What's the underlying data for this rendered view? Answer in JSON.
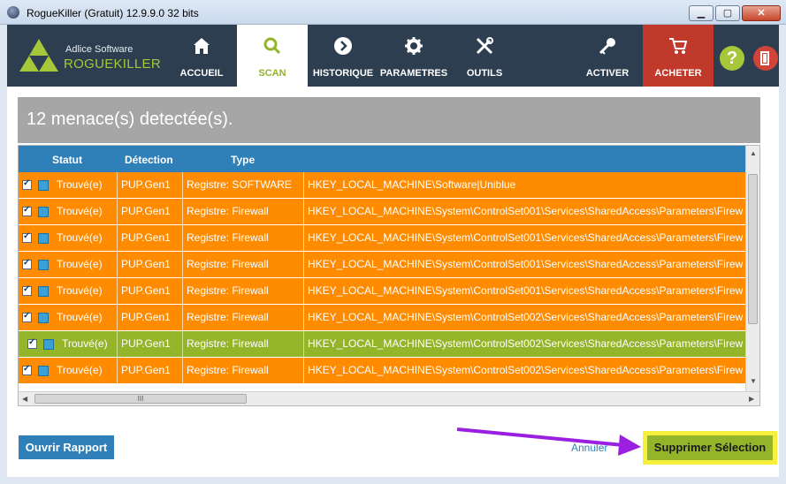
{
  "window": {
    "title": "RogueKiller (Gratuit) 12.9.9.0 32 bits",
    "minimize": "▁",
    "maximize": "▢",
    "close": "✕"
  },
  "brand": {
    "company": "Adlice Software",
    "product": "ROGUEKILLER"
  },
  "nav": [
    {
      "id": "accueil",
      "label": "ACCUEIL",
      "icon": "home-icon"
    },
    {
      "id": "scan",
      "label": "SCAN",
      "icon": "search-icon",
      "active": true
    },
    {
      "id": "historique",
      "label": "HISTORIQUE",
      "icon": "chevron-right-circle-icon"
    },
    {
      "id": "parametres",
      "label": "PARAMETRES",
      "icon": "gear-icon"
    },
    {
      "id": "outils",
      "label": "OUTILS",
      "icon": "tools-icon"
    },
    {
      "id": "activer",
      "label": "ACTIVER",
      "icon": "key-icon"
    },
    {
      "id": "acheter",
      "label": "ACHETER",
      "icon": "cart-icon"
    }
  ],
  "help_label": "?",
  "panel_title": "12 menace(s) detectée(s).",
  "table": {
    "columns": [
      "Statut",
      "Détection",
      "Type",
      ""
    ],
    "rows": [
      {
        "status": "Trouvé(e)",
        "detection": "PUP.Gen1",
        "type": "Registre: SOFTWARE",
        "path": "HKEY_LOCAL_MACHINE\\Software|Uniblue"
      },
      {
        "status": "Trouvé(e)",
        "detection": "PUP.Gen1",
        "type": "Registre: Firewall",
        "path": "HKEY_LOCAL_MACHINE\\System\\ControlSet001\\Services\\SharedAccess\\Parameters\\Firew"
      },
      {
        "status": "Trouvé(e)",
        "detection": "PUP.Gen1",
        "type": "Registre: Firewall",
        "path": "HKEY_LOCAL_MACHINE\\System\\ControlSet001\\Services\\SharedAccess\\Parameters\\Firew"
      },
      {
        "status": "Trouvé(e)",
        "detection": "PUP.Gen1",
        "type": "Registre: Firewall",
        "path": "HKEY_LOCAL_MACHINE\\System\\ControlSet001\\Services\\SharedAccess\\Parameters\\Firew"
      },
      {
        "status": "Trouvé(e)",
        "detection": "PUP.Gen1",
        "type": "Registre: Firewall",
        "path": "HKEY_LOCAL_MACHINE\\System\\ControlSet001\\Services\\SharedAccess\\Parameters\\Firew"
      },
      {
        "status": "Trouvé(e)",
        "detection": "PUP.Gen1",
        "type": "Registre: Firewall",
        "path": "HKEY_LOCAL_MACHINE\\System\\ControlSet002\\Services\\SharedAccess\\Parameters\\Firew"
      },
      {
        "status": "Trouvé(e)",
        "detection": "PUP.Gen1",
        "type": "Registre: Firewall",
        "path": "HKEY_LOCAL_MACHINE\\System\\ControlSet002\\Services\\SharedAccess\\Parameters\\Firew"
      },
      {
        "status": "Trouvé(e)",
        "detection": "PUP.Gen1",
        "type": "Registre: Firewall",
        "path": "HKEY_LOCAL_MACHINE\\System\\ControlSet002\\Services\\SharedAccess\\Parameters\\Firew"
      }
    ],
    "selected_row": 6,
    "hscroll_grip": "III"
  },
  "buttons": {
    "report": "Ouvrir Rapport",
    "cancel": "Annuler",
    "delete": "Supprimer Sélection"
  },
  "colors": {
    "nav_bg": "#2d3e50",
    "accent_green": "#94b52a",
    "row_orange": "#ff8c00",
    "header_blue": "#2f80b8",
    "buy_red": "#c0392b",
    "highlight_yellow": "#f6ef3c",
    "arrow_purple": "#9b1fe0"
  }
}
